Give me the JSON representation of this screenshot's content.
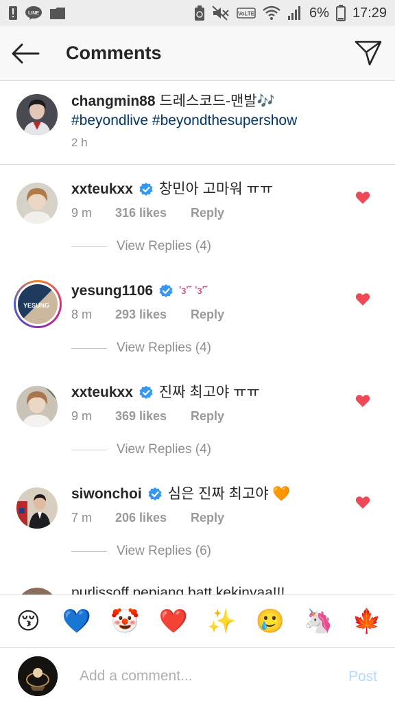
{
  "status_bar": {
    "battery_percent": "6%",
    "time": "17:29",
    "icons": [
      "alert-icon",
      "line-app-icon",
      "gallery-icon",
      "recycle-icon",
      "mute-icon",
      "volte-icon",
      "wifi-icon",
      "signal-icon",
      "battery-icon"
    ]
  },
  "header": {
    "title": "Comments",
    "back_icon": "arrow-left-icon",
    "send_icon": "paper-plane-icon"
  },
  "caption": {
    "username": "changmin88",
    "text": "드레스코드-맨발🎶",
    "hashtags": "#beyondlive #beyondthesupershow",
    "time": "2 h"
  },
  "comments": [
    {
      "username": "xxteukxx",
      "verified": true,
      "text": "창민아 고마워 ㅠㅠ",
      "time": "9 m",
      "likes": "316 likes",
      "reply": "Reply",
      "view_replies": "View Replies (4)"
    },
    {
      "username": "yesung1106",
      "verified": true,
      "text": "'з'˘ 'з'˘",
      "time": "8 m",
      "likes": "293 likes",
      "reply": "Reply",
      "view_replies": "View Replies (4)",
      "avatar_label": "YESUNG"
    },
    {
      "username": "xxteukxx",
      "verified": true,
      "text": "진짜 최고야 ㅠㅠ",
      "time": "9 m",
      "likes": "369 likes",
      "reply": "Reply",
      "view_replies": "View Replies (4)"
    },
    {
      "username": "siwonchoi",
      "verified": true,
      "text": "심은 진짜 최고야 🧡",
      "time": "7 m",
      "likes": "206 likes",
      "reply": "Reply",
      "view_replies": "View Replies (6)"
    }
  ],
  "peek_comment": "purlissoff pepiang batt kekinyaa!!!",
  "emoji_bar": [
    "😚",
    "💙",
    "🤡",
    "❤️",
    "✨",
    "🥲",
    "🦄",
    "🍁"
  ],
  "composer": {
    "placeholder": "Add a comment...",
    "post_label": "Post"
  },
  "colors": {
    "heart": "#ed4956",
    "verified": "#3897f0",
    "hashtag": "#003569",
    "muted": "#8e8e8e",
    "post_disabled": "#b3dbff"
  }
}
